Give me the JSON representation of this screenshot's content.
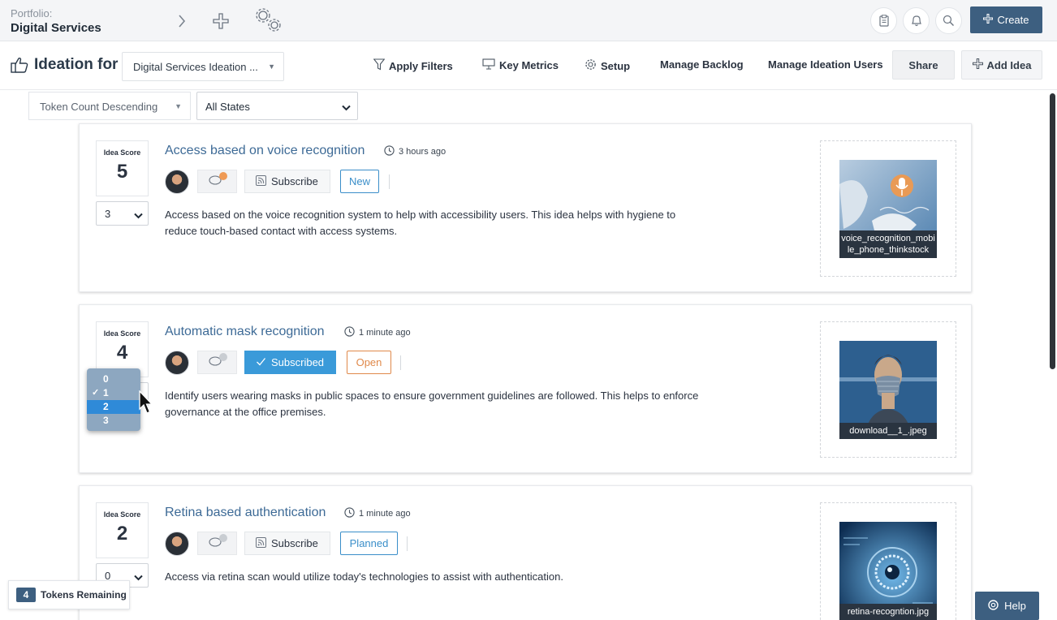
{
  "topbar": {
    "portfolio_label": "Portfolio:",
    "portfolio_name": "Digital Services",
    "create_label": "Create",
    "icons": [
      "chevron-right-icon",
      "plus-icon",
      "settings-gears-icon",
      "clipboard-icon",
      "bell-icon",
      "search-icon"
    ]
  },
  "ideation": {
    "title": "Ideation for",
    "project_select": "Digital Services Ideation ...",
    "nav": {
      "apply_filters": "Apply Filters",
      "key_metrics": "Key Metrics",
      "setup": "Setup",
      "manage_backlog": "Manage Backlog",
      "manage_users": "Manage Ideation Users",
      "share": "Share",
      "add_idea": "Add Idea"
    }
  },
  "filters": {
    "sort": "Token Count Descending",
    "state": "All States"
  },
  "ideas": [
    {
      "score_label": "Idea Score",
      "score": "5",
      "token_select": "3",
      "title": "Access based on voice recognition",
      "time": "3 hours ago",
      "subscribe_label": "Subscribe",
      "subscribed": false,
      "state": "New",
      "description": "Access based on the voice recognition system to help with accessibility users. This idea helps with hygiene to reduce touch-based contact with access systems.",
      "image_caption": "voice_recognition_mobile_phone_thinkstock"
    },
    {
      "score_label": "Idea Score",
      "score": "4",
      "token_select": "2",
      "title": "Automatic mask recognition",
      "time": "1 minute ago",
      "subscribe_label": "Subscribed",
      "subscribed": true,
      "state": "Open",
      "description": "Identify users wearing masks in public spaces to ensure government guidelines are followed. This helps to enforce governance at the office premises.",
      "image_caption": "download__1_.jpeg"
    },
    {
      "score_label": "Idea Score",
      "score": "2",
      "token_select": "0",
      "title": "Retina based authentication",
      "time": "1 minute ago",
      "subscribe_label": "Subscribe",
      "subscribed": false,
      "state": "Planned",
      "description": "Access via retina scan would utilize today's technologies to assist with authentication.",
      "image_caption": "retina-recogntion.jpg"
    }
  ],
  "dropdown": {
    "options": [
      "0",
      "1",
      "2",
      "3"
    ],
    "checked": "1",
    "highlighted": "2"
  },
  "footer": {
    "tokens_count": "4",
    "tokens_label": "Tokens Remaining",
    "help_label": "Help"
  },
  "colors": {
    "accent": "#3d5f80",
    "link": "#3d6a96",
    "subscribed": "#3a9ad9",
    "state_new": "#3a8ec9",
    "state_open": "#e0894a",
    "state_planned": "#3a8ec9"
  }
}
